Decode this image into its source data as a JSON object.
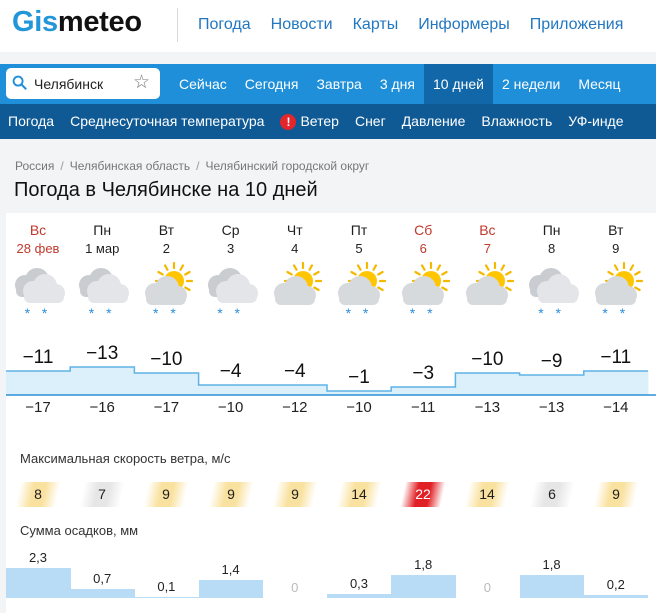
{
  "header": {
    "logo_part1": "Gis",
    "logo_part2": "meteo",
    "nav": [
      "Погода",
      "Новости",
      "Карты",
      "Информеры",
      "Приложения"
    ]
  },
  "search": {
    "value": "Челябинск"
  },
  "period_tabs": [
    "Сейчас",
    "Сегодня",
    "Завтра",
    "3 дня",
    "10 дней",
    "2 недели",
    "Месяц"
  ],
  "active_period": "10 дней",
  "param_tabs": [
    "Погода",
    "Среднесуточная температура",
    "Ветер",
    "Снег",
    "Давление",
    "Влажность",
    "УФ-инде"
  ],
  "breadcrumb": [
    "Россия",
    "Челябинская область",
    "Челябинский городской округ"
  ],
  "title": "Погода в Челябинске на 10 дней",
  "wind_title": "Максимальная скорость ветра, м/с",
  "precip_title": "Сумма осадков, мм",
  "colors": {
    "accent": "#1e8fd8",
    "dark_bar": "#0f5a95",
    "weekend": "#c0392b",
    "wind_calm": "#f9e2a0",
    "wind_grey": "#e6e6e6",
    "wind_strong": "#e12025",
    "precip": "#b9dcf6"
  },
  "days": [
    {
      "name": "Вс",
      "date": "28 фев",
      "weekend": true,
      "icon": "cloudy-snow-icon",
      "snow": "* *",
      "tmax": "−11",
      "tmin": "−17",
      "tmax_v": -11,
      "wind": "8",
      "wind_level": "calm",
      "precip": "2,3",
      "precip_v": 2.3
    },
    {
      "name": "Пн",
      "date": "1 мар",
      "weekend": false,
      "icon": "cloudy-snow-icon",
      "snow": "* *",
      "tmax": "−13",
      "tmin": "−16",
      "tmax_v": -13,
      "wind": "7",
      "wind_level": "grey",
      "precip": "0,7",
      "precip_v": 0.7
    },
    {
      "name": "Вт",
      "date": "2",
      "weekend": false,
      "icon": "partly-cloudy-snow-icon",
      "snow": "* *",
      "tmax": "−10",
      "tmin": "−17",
      "tmax_v": -10,
      "wind": "9",
      "wind_level": "calm",
      "precip": "0,1",
      "precip_v": 0.1
    },
    {
      "name": "Ср",
      "date": "3",
      "weekend": false,
      "icon": "cloudy-snow-icon",
      "snow": "* *",
      "tmax": "−4",
      "tmin": "−10",
      "tmax_v": -4,
      "wind": "9",
      "wind_level": "calm",
      "precip": "1,4",
      "precip_v": 1.4
    },
    {
      "name": "Чт",
      "date": "4",
      "weekend": false,
      "icon": "partly-cloudy-icon",
      "snow": "",
      "tmax": "−4",
      "tmin": "−12",
      "tmax_v": -4,
      "wind": "9",
      "wind_level": "calm",
      "precip": "0",
      "precip_v": 0
    },
    {
      "name": "Пт",
      "date": "5",
      "weekend": false,
      "icon": "partly-cloudy-snow-icon",
      "snow": "* *",
      "tmax": "−1",
      "tmin": "−10",
      "tmax_v": -1,
      "wind": "14",
      "wind_level": "calm",
      "precip": "0,3",
      "precip_v": 0.3
    },
    {
      "name": "Сб",
      "date": "6",
      "weekend": true,
      "icon": "partly-cloudy-snow-icon",
      "snow": "* *",
      "tmax": "−3",
      "tmin": "−11",
      "tmax_v": -3,
      "wind": "22",
      "wind_level": "strong",
      "precip": "1,8",
      "precip_v": 1.8
    },
    {
      "name": "Вс",
      "date": "7",
      "weekend": true,
      "icon": "partly-cloudy-icon",
      "snow": "",
      "tmax": "−10",
      "tmin": "−13",
      "tmax_v": -10,
      "wind": "14",
      "wind_level": "calm",
      "precip": "0",
      "precip_v": 0
    },
    {
      "name": "Пн",
      "date": "8",
      "weekend": false,
      "icon": "cloudy-snow-icon",
      "snow": "* *",
      "tmax": "−9",
      "tmin": "−13",
      "tmax_v": -9,
      "wind": "6",
      "wind_level": "grey",
      "precip": "1,8",
      "precip_v": 1.8
    },
    {
      "name": "Вт",
      "date": "9",
      "weekend": false,
      "icon": "partly-cloudy-snow-icon",
      "snow": "* *",
      "tmax": "−11",
      "tmin": "−14",
      "tmax_v": -11,
      "wind": "9",
      "wind_level": "calm",
      "precip": "0,2",
      "precip_v": 0.2
    }
  ]
}
